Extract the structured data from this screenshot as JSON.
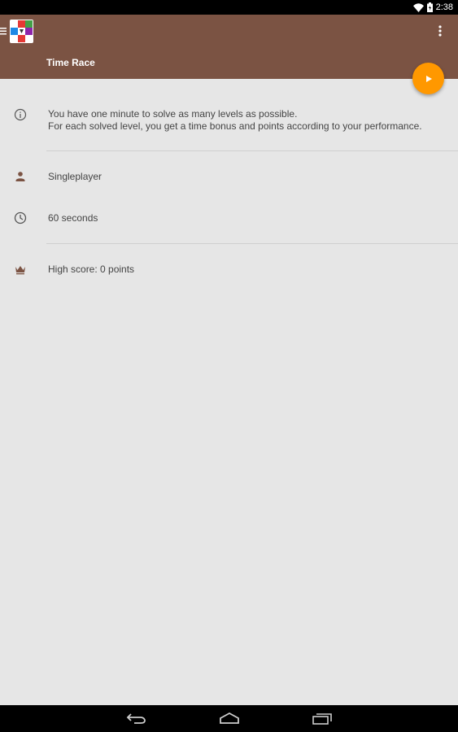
{
  "status_bar": {
    "time": "2:38",
    "icons": [
      "wifi-icon",
      "battery-icon"
    ]
  },
  "app_bar": {
    "title": "Time Race",
    "menu_icon": "hamburger-icon",
    "overflow_icon": "more-vert-icon",
    "background": "#7b5343"
  },
  "fab": {
    "icon": "play-icon",
    "color": "#ff9800"
  },
  "info": {
    "line1": "You have one minute to solve as many levels as possible.",
    "line2": "For each solved level, you get a time bonus and points according to your performance."
  },
  "settings": {
    "players": "Singleplayer",
    "duration": "60 seconds"
  },
  "high_score": "High score: 0 points",
  "nav_bar": {
    "buttons": [
      "back-icon",
      "home-icon",
      "recents-icon"
    ]
  }
}
